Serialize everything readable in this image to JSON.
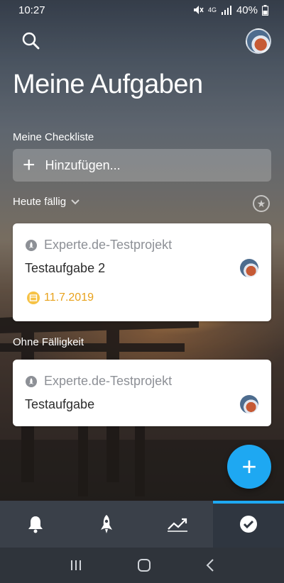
{
  "status": {
    "time": "10:27",
    "battery": "40%",
    "network": "4G"
  },
  "header": {
    "title": "Meine Aufgaben"
  },
  "checklist": {
    "label": "Meine Checkliste",
    "add_placeholder": "Hinzufügen..."
  },
  "due_today": {
    "label": "Heute fällig",
    "task": {
      "project": "Experte.de-Testprojekt",
      "title": "Testaufgabe 2",
      "date": "11.7.2019"
    }
  },
  "no_due": {
    "label": "Ohne Fälligkeit",
    "task": {
      "project": "Experte.de-Testprojekt",
      "title": "Testaufgabe"
    }
  },
  "fab": {
    "icon": "plus-icon"
  },
  "nav": {
    "items": [
      {
        "icon": "bell-icon",
        "active": false
      },
      {
        "icon": "rocket-icon",
        "active": false
      },
      {
        "icon": "trend-icon",
        "active": false
      },
      {
        "icon": "check-circle-icon",
        "active": true
      }
    ]
  },
  "colors": {
    "accent": "#1ea8f2",
    "date": "#e8a21c",
    "nav_bg": "#3a4049"
  }
}
